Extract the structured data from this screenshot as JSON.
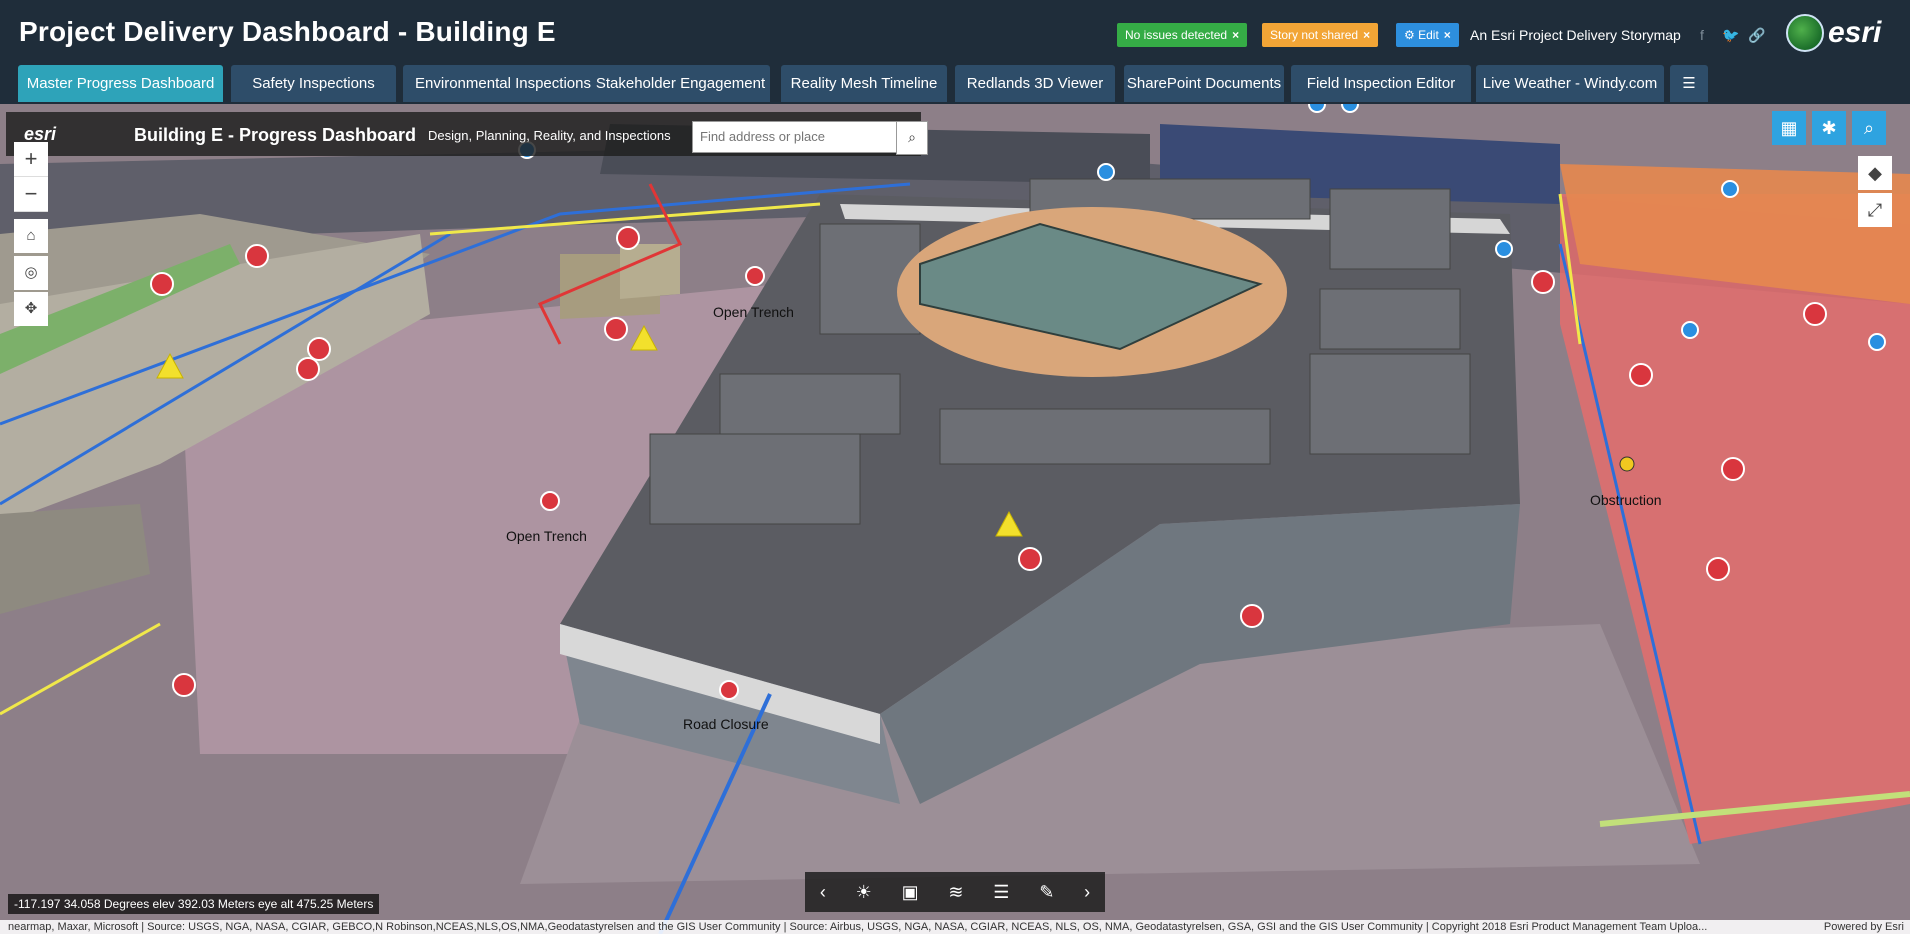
{
  "header": {
    "title": "Project Delivery Dashboard - Building E",
    "badges": {
      "no_issues": "No issues detected",
      "not_shared": "Story not shared",
      "edit": "Edit"
    },
    "storymap_label": "An Esri Project Delivery Storymap",
    "logo_text": "esri"
  },
  "tabs": [
    {
      "label": "Master Progress Dashboard",
      "active": true
    },
    {
      "label": "Safety Inspections"
    },
    {
      "label": "Environmental Inspections"
    },
    {
      "label": "Stakeholder Engagement"
    },
    {
      "label": "Reality Mesh Timeline"
    },
    {
      "label": "Redlands 3D Viewer"
    },
    {
      "label": "SharePoint Documents"
    },
    {
      "label": "Field Inspection Editor"
    },
    {
      "label": "Live Weather - Windy.com"
    },
    {
      "label": "☰"
    }
  ],
  "map": {
    "logo_text": "esri",
    "title": "Building E - Progress Dashboard",
    "subtitle": "Design, Planning, Reality, and Inspections",
    "search_placeholder": "Find address or place",
    "coordinates": "-117.197 34.058 Degrees   elev 392.03 Meters   eye alt 475.25 Meters",
    "attribution": "nearmap, Maxar, Microsoft | Source: USGS, NGA, NASA, CGIAR, GEBCO,N Robinson,NCEAS,NLS,OS,NMA,Geodatastyrelsen and the GIS User Community | Source: Airbus, USGS, NGA, NASA, CGIAR, NCEAS, NLS, OS, NMA, Geodatastyrelsen, GSA, GSI and the GIS User Community | Copyright 2018 Esri Product Management Team Uploa...",
    "powered_by": "Powered by Esri",
    "labels": {
      "open_trench_1": "Open Trench",
      "open_trench_2": "Open Trench",
      "obstruction": "Obstruction",
      "road_closure": "Road Closure"
    }
  },
  "colors": {
    "header_bg": "#1f2d3a",
    "tab_bg": "#2e4d69",
    "tab_active": "#2ea3b9",
    "badge_green": "#35ac46",
    "badge_orange": "#f2a536",
    "badge_blue": "#2d8fde"
  },
  "icons": [
    "facebook-icon",
    "twitter-icon",
    "link-icon",
    "search-icon",
    "zoom-in-icon",
    "zoom-out-icon",
    "home-icon",
    "locate-icon",
    "pan-icon",
    "basemap-gallery-icon",
    "measure-icon",
    "compass-icon",
    "fullscreen-icon",
    "daylight-icon",
    "slides-icon",
    "layers-icon",
    "legend-icon",
    "edit-pencil-icon"
  ]
}
